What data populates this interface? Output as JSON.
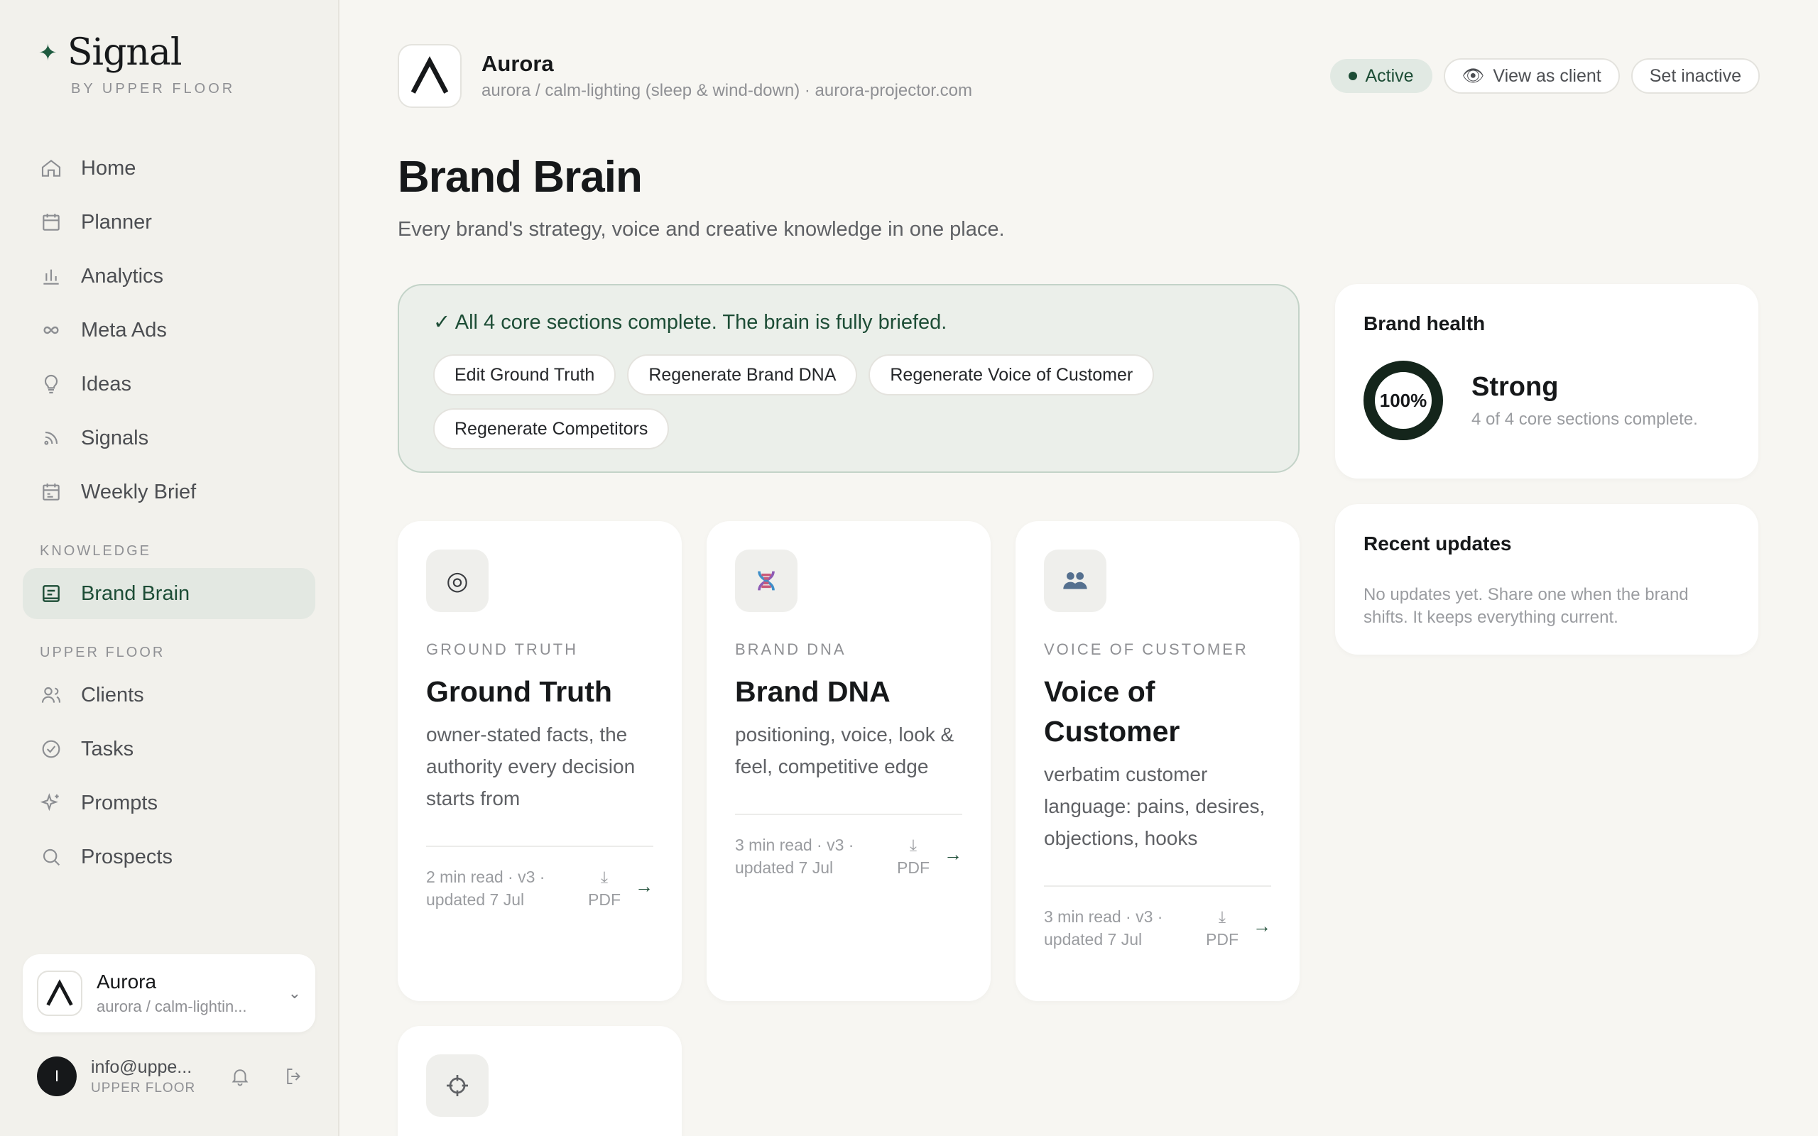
{
  "sidebar": {
    "logo_text": "Signal",
    "logo_sub": "BY UPPER FLOOR",
    "nav": [
      {
        "label": "Home"
      },
      {
        "label": "Planner"
      },
      {
        "label": "Analytics"
      },
      {
        "label": "Meta Ads"
      },
      {
        "label": "Ideas"
      },
      {
        "label": "Signals"
      },
      {
        "label": "Weekly Brief"
      }
    ],
    "knowledge_section": "KNOWLEDGE",
    "knowledge_items": [
      {
        "label": "Brand Brain"
      }
    ],
    "upper_section": "UPPER FLOOR",
    "upper_items": [
      {
        "label": "Clients"
      },
      {
        "label": "Tasks"
      },
      {
        "label": "Prompts"
      },
      {
        "label": "Prospects"
      }
    ],
    "client_switcher": {
      "name": "Aurora",
      "path": "aurora / calm-lightin..."
    },
    "user": {
      "initial": "I",
      "email": "info@uppe...",
      "org": "UPPER FLOOR"
    }
  },
  "header": {
    "brand_name": "Aurora",
    "brand_desc": "aurora / calm-lighting (sleep & wind-down) · aurora-projector.com",
    "status": "Active",
    "view_as_client": "View as client",
    "set_inactive": "Set inactive"
  },
  "page": {
    "title": "Brand Brain",
    "subtitle": "Every brand's strategy, voice and creative knowledge in one place."
  },
  "banner": {
    "text": "✓ All 4 core sections complete. The brain is fully briefed.",
    "chips": [
      "Edit Ground Truth",
      "Regenerate Brand DNA",
      "Regenerate Voice of Customer",
      "Regenerate Competitors"
    ]
  },
  "cards": [
    {
      "kicker": "GROUND TRUTH",
      "title": "Ground Truth",
      "desc": "owner-stated facts, the authority every decision starts from",
      "meta": "2 min read · v3 · updated 7 Jul",
      "pdf": "PDF"
    },
    {
      "kicker": "BRAND DNA",
      "title": "Brand DNA",
      "desc": "positioning, voice, look & feel, competitive edge",
      "meta": "3 min read · v3 · updated 7 Jul",
      "pdf": "PDF"
    },
    {
      "kicker": "VOICE OF CUSTOMER",
      "title": "Voice of Customer",
      "desc": "verbatim customer language: pains, desires, objections, hooks",
      "meta": "3 min read · v3 · updated 7 Jul",
      "pdf": "PDF"
    }
  ],
  "brand_health": {
    "title": "Brand health",
    "percent": "100%",
    "label": "Strong",
    "sub": "4 of 4 core sections complete."
  },
  "recent_updates": {
    "title": "Recent updates",
    "text": "No updates yet. Share one when the brand shifts. It keeps everything current."
  },
  "icons": {
    "card_1": "target-icon",
    "card_2": "dna-icon",
    "card_3": "people-icon",
    "card_4": "crosshair-icon"
  },
  "colors": {
    "accent": "#1d4d36",
    "background": "#f7f6f2"
  }
}
